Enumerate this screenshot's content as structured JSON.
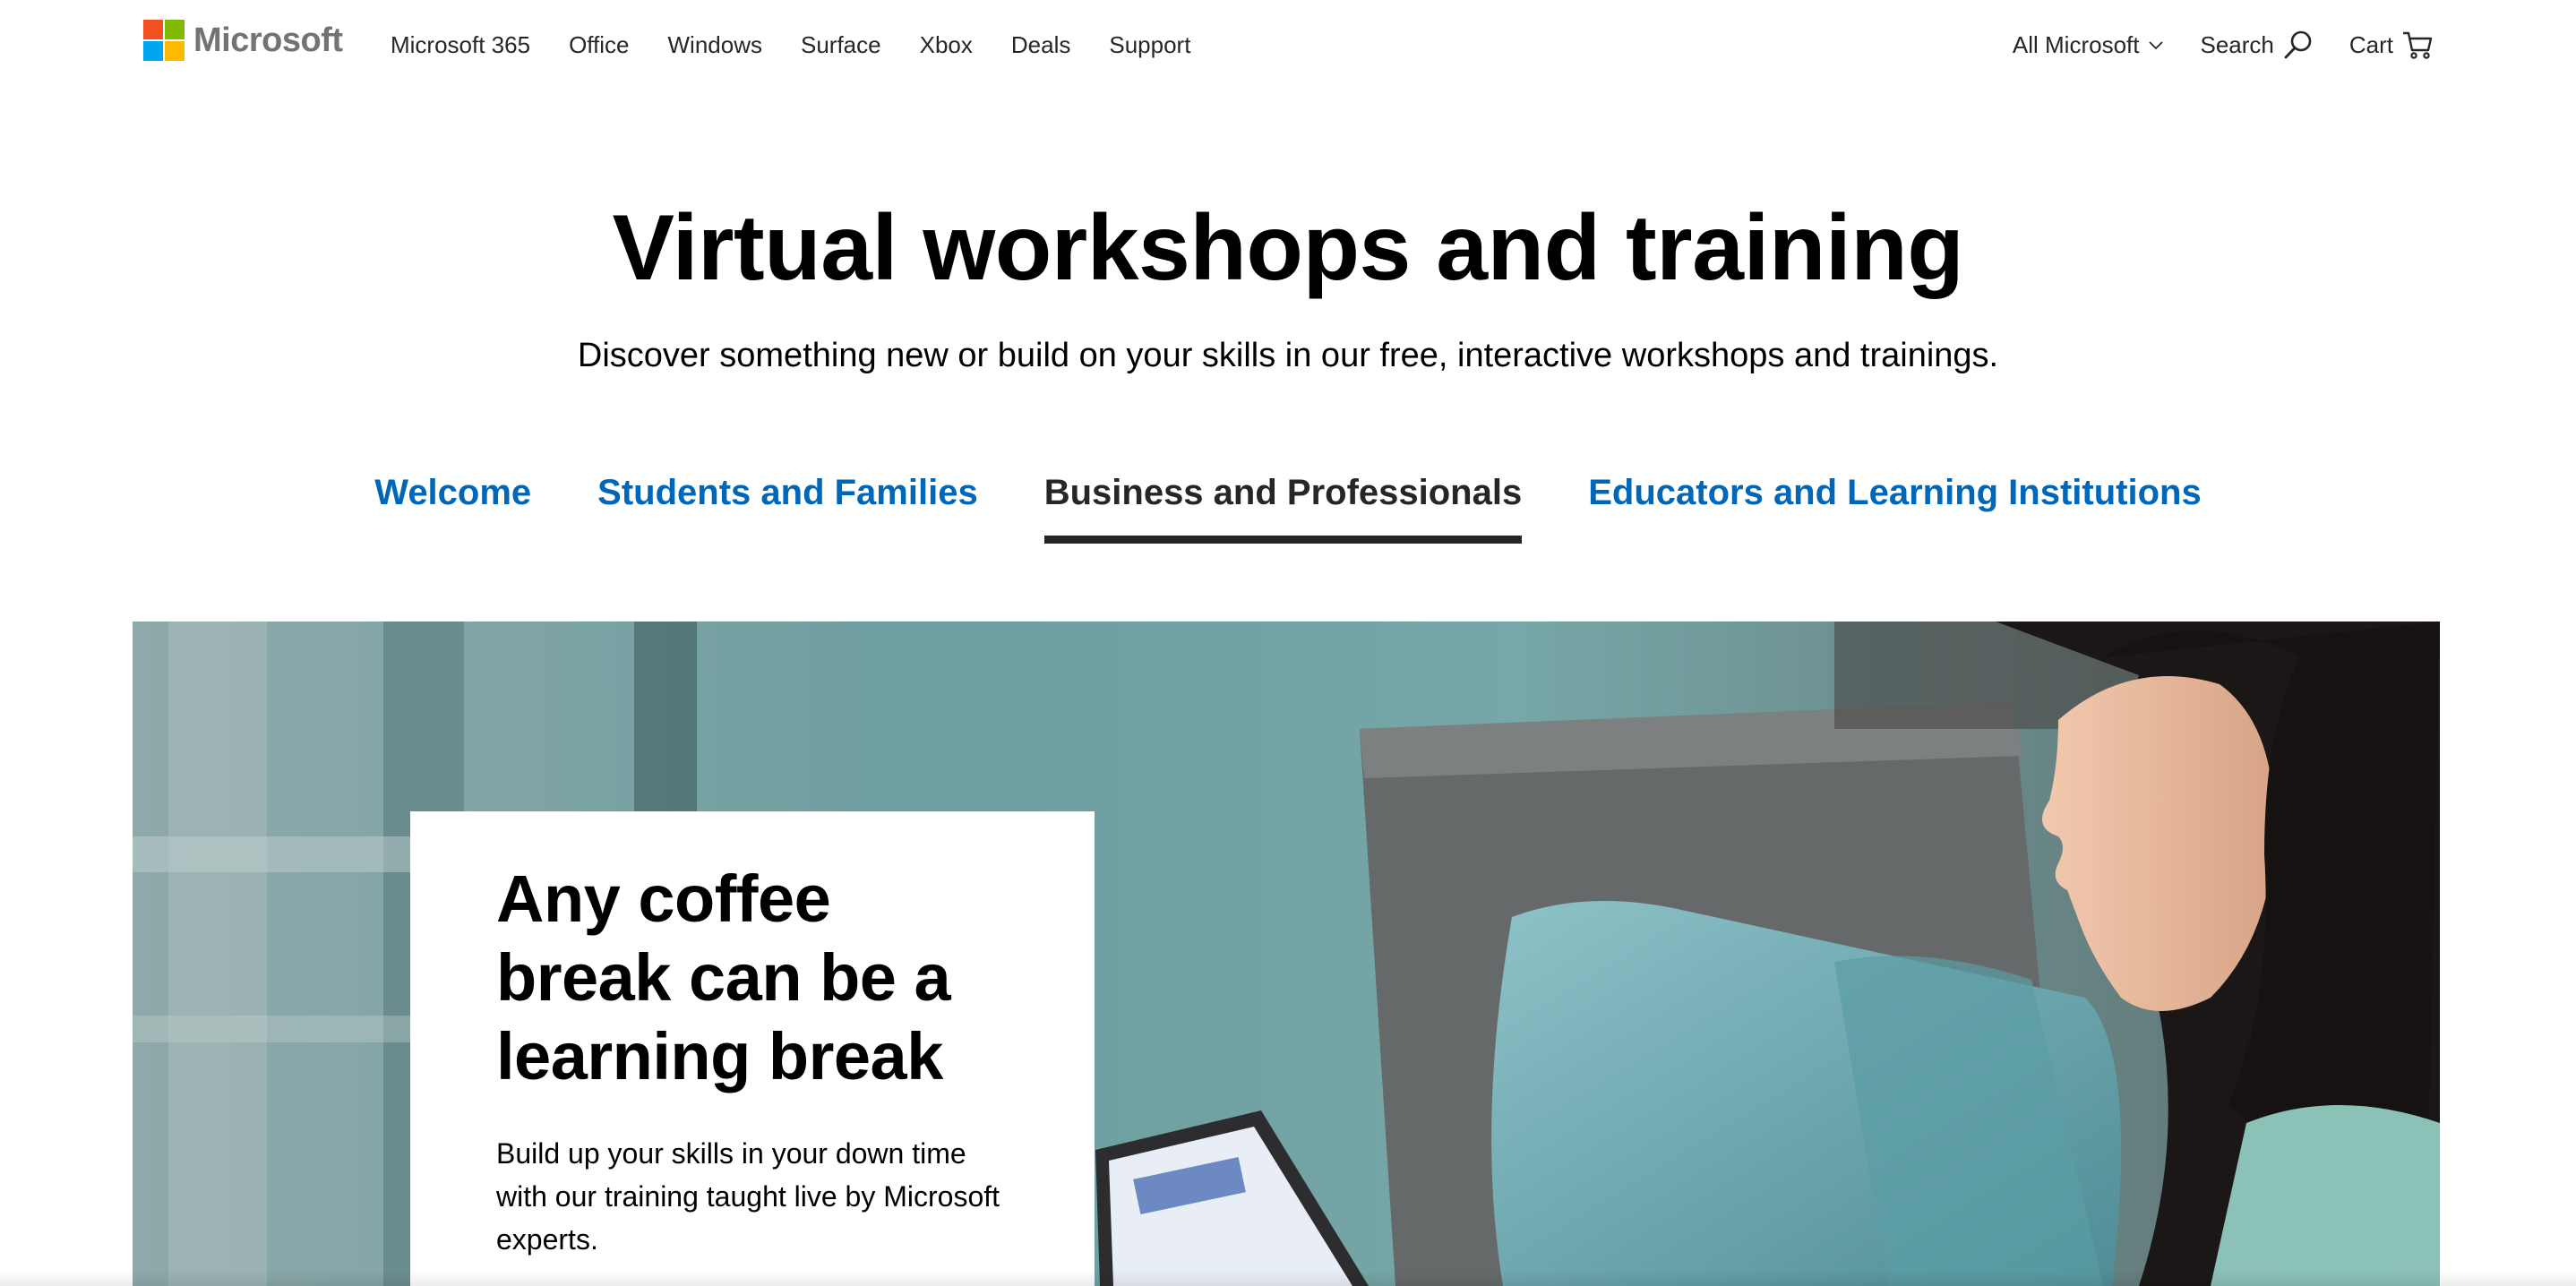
{
  "header": {
    "logo": {
      "text": "Microsoft",
      "colors": [
        "#f25022",
        "#7fba00",
        "#00a4ef",
        "#ffb900"
      ]
    },
    "nav": [
      {
        "label": "Microsoft 365"
      },
      {
        "label": "Office"
      },
      {
        "label": "Windows"
      },
      {
        "label": "Surface"
      },
      {
        "label": "Xbox"
      },
      {
        "label": "Deals"
      },
      {
        "label": "Support"
      }
    ],
    "all_microsoft": {
      "label": "All Microsoft",
      "icon": "chevron-down-icon"
    },
    "search": {
      "label": "Search",
      "icon": "search-icon"
    },
    "cart": {
      "label": "Cart",
      "icon": "cart-icon"
    }
  },
  "hero": {
    "title": "Virtual workshops and training",
    "subtitle": "Discover something new or build on your skills in our free, interactive workshops and trainings."
  },
  "tabs": {
    "items": [
      {
        "label": "Welcome",
        "active": false
      },
      {
        "label": "Students and Families",
        "active": false
      },
      {
        "label": "Business and Professionals",
        "active": true
      },
      {
        "label": "Educators and Learning Institutions",
        "active": false
      }
    ]
  },
  "banner": {
    "card": {
      "title": "Any coffee break can be a learning break",
      "body": "Build up your skills in your down time with our training taught live by Microsoft experts."
    }
  },
  "colors": {
    "link": "#0067b8",
    "active_tab": "#262626",
    "text": "#000000"
  }
}
